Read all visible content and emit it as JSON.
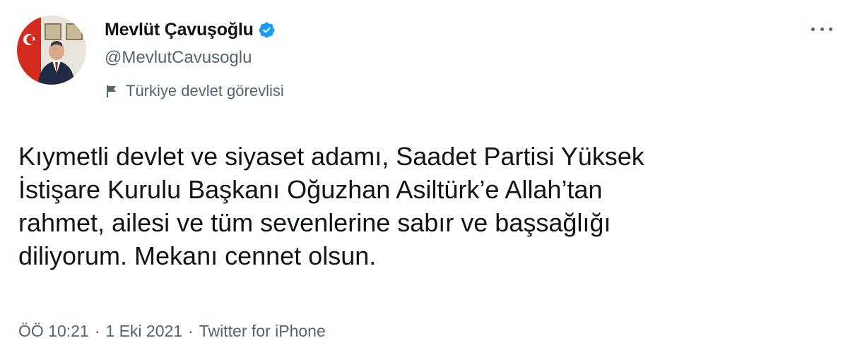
{
  "author": {
    "display_name": "Mevlüt Çavuşoğlu",
    "handle": "@MevlutCavusoglu",
    "verified": true,
    "label": "Türkiye devlet görevlisi"
  },
  "tweet": {
    "lines": [
      "Kıymetli devlet ve siyaset adamı, Saadet Partisi Yüksek",
      "İstişare Kurulu Başkanı Oğuzhan Asiltürk’e Allah’tan",
      "rahmet, ailesi ve tüm sevenlerine sabır ve başsağlığı",
      "diliyorum. Mekanı cennet olsun."
    ]
  },
  "meta": {
    "time": "ÖÖ 10:21",
    "separator": "·",
    "date": "1 Eki 2021",
    "source": "Twitter for iPhone"
  },
  "icons": {
    "verified": "verified-badge-icon",
    "label": "flag-icon",
    "more": "more-options-icon"
  },
  "colors": {
    "text": "#0f1419",
    "secondary": "#536471",
    "verified": "#1d9bf0"
  }
}
